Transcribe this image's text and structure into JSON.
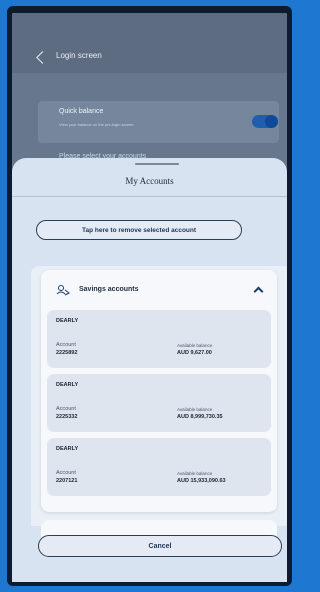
{
  "background_screen": {
    "title": "Login screen",
    "quick_balance_label": "Quick balance",
    "quick_balance_desc": "View your balance on the pre-login screen",
    "select_accounts_text": "Please select your accounts",
    "quick_balance_enabled": true
  },
  "sheet": {
    "title": "My Accounts",
    "remove_button_label": "Tap here to remove selected account",
    "cancel_button_label": "Cancel"
  },
  "group": {
    "label": "Savings accounts",
    "expanded": true
  },
  "accounts": [
    {
      "name": "DEARLY",
      "account_label": "Account",
      "account_number": "2225892",
      "balance_label": "Available balance",
      "balance": "AUD 9,627.00"
    },
    {
      "name": "DEARLY",
      "account_label": "Account",
      "account_number": "2225332",
      "balance_label": "Available balance",
      "balance": "AUD 8,999,730.35"
    },
    {
      "name": "DEARLY",
      "account_label": "Account",
      "account_number": "2207121",
      "balance_label": "Available balance",
      "balance": "AUD 15,933,090.63"
    }
  ],
  "colors": {
    "frame": "#1e78d2",
    "accent": "#163d6c",
    "toggle": "#1e5fb0"
  }
}
